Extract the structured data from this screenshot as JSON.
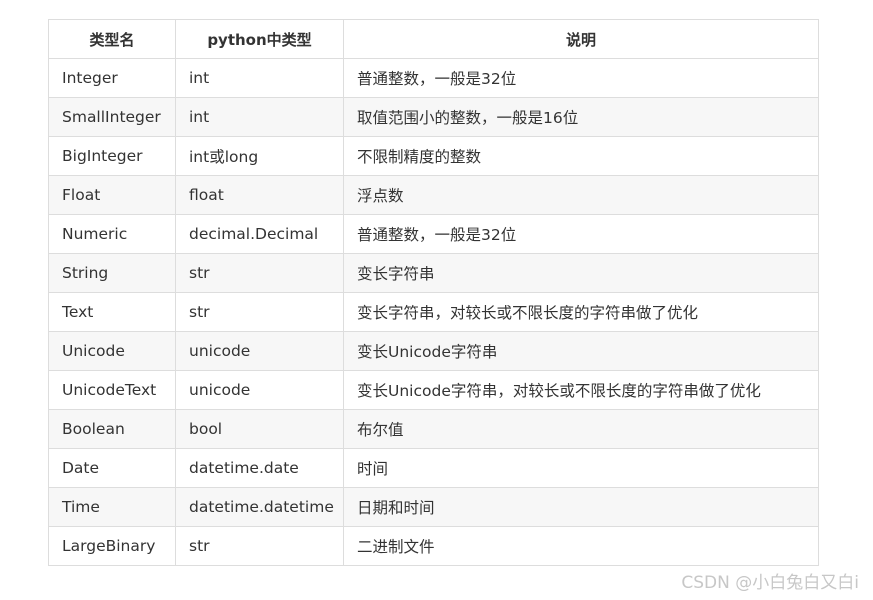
{
  "table": {
    "headers": [
      "类型名",
      "python中类型",
      "说明"
    ],
    "rows": [
      [
        "Integer",
        "int",
        "普通整数，一般是32位"
      ],
      [
        "SmallInteger",
        "int",
        "取值范围小的整数，一般是16位"
      ],
      [
        "BigInteger",
        "int或long",
        "不限制精度的整数"
      ],
      [
        "Float",
        "float",
        "浮点数"
      ],
      [
        "Numeric",
        "decimal.Decimal",
        "普通整数，一般是32位"
      ],
      [
        "String",
        "str",
        "变长字符串"
      ],
      [
        "Text",
        "str",
        "变长字符串，对较长或不限长度的字符串做了优化"
      ],
      [
        "Unicode",
        "unicode",
        "变长Unicode字符串"
      ],
      [
        "UnicodeText",
        "unicode",
        "变长Unicode字符串，对较长或不限长度的字符串做了优化"
      ],
      [
        "Boolean",
        "bool",
        "布尔值"
      ],
      [
        "Date",
        "datetime.date",
        "时间"
      ],
      [
        "Time",
        "datetime.datetime",
        "日期和时间"
      ],
      [
        "LargeBinary",
        "str",
        "二进制文件"
      ]
    ]
  },
  "watermark": "CSDN @小白兔白又白i"
}
